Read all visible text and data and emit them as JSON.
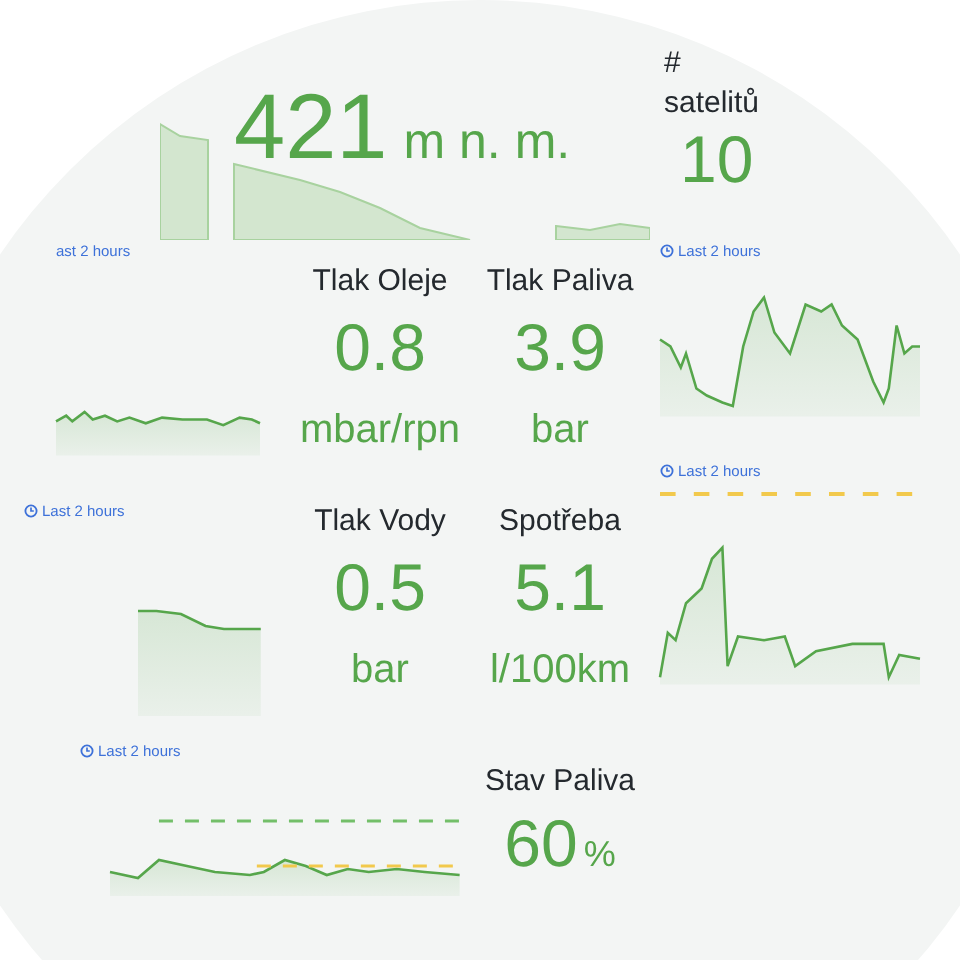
{
  "altitude": {
    "value": "421",
    "unit": "m n. m."
  },
  "satellites": {
    "title": "# satelitů",
    "value": "10"
  },
  "charts": [
    {
      "time_label": "ast 2 hours"
    },
    {
      "time_label": "Last 2 hours"
    },
    {
      "time_label": "Last 2 hours"
    },
    {
      "time_label": "Last 2 hours"
    },
    {
      "time_label": "Last 2 hours"
    }
  ],
  "stats": [
    {
      "title": "Tlak Oleje",
      "value": "0.8",
      "unit": "mbar/rpn",
      "kind": "below"
    },
    {
      "title": "Tlak Paliva",
      "value": "3.9",
      "unit": "bar",
      "kind": "below"
    },
    {
      "title": "Tlak Vody",
      "value": "0.5",
      "unit": "bar",
      "kind": "below"
    },
    {
      "title": "Spotřeba",
      "value": "5.1",
      "unit": "l/100km",
      "kind": "below"
    },
    {
      "title": "Stav Paliva",
      "value": "60",
      "unit": "%",
      "kind": "inline"
    }
  ]
}
